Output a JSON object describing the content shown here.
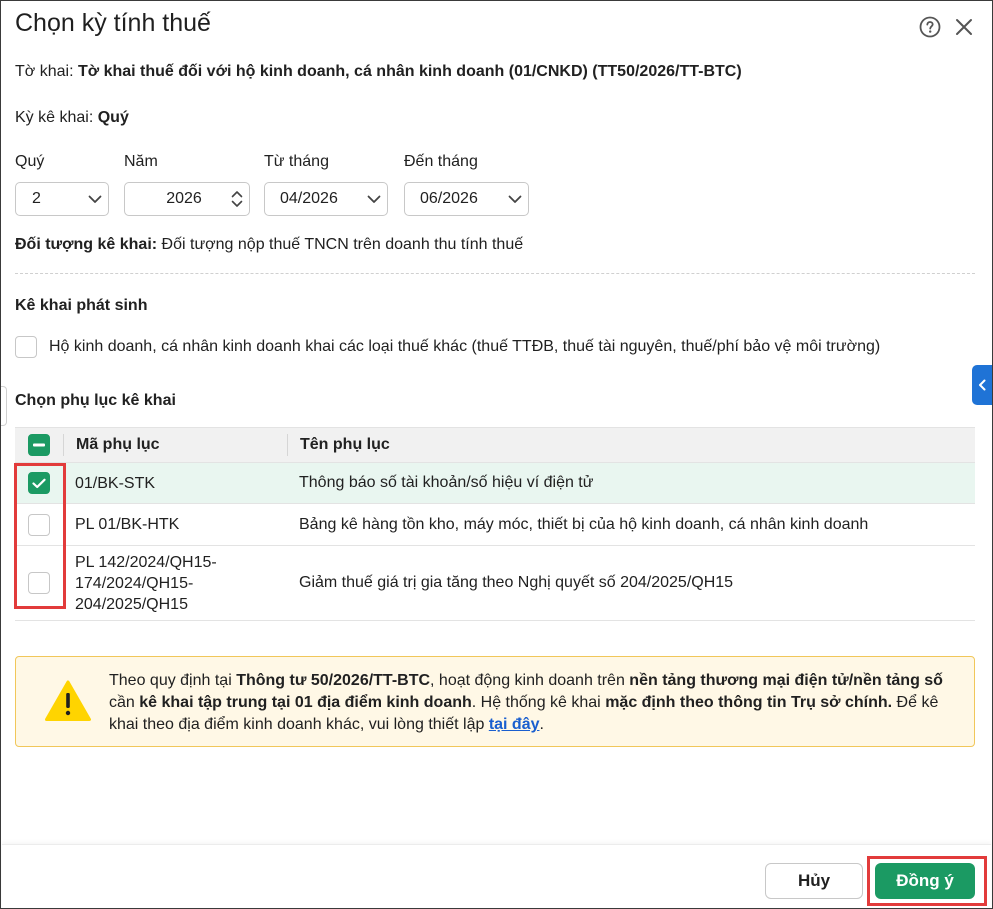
{
  "dialog": {
    "title": "Chọn kỳ tính thuế"
  },
  "form_info": {
    "to_khai_label": "Tờ khai:",
    "to_khai_value": "Tờ khai thuế đối với hộ kinh doanh, cá nhân kinh doanh (01/CNKD) (TT50/2026/TT-BTC)",
    "ky_ke_khai_label": "Kỳ kê khai:",
    "ky_ke_khai_value": "Quý"
  },
  "fields": {
    "quy_label": "Quý",
    "quy_value": "2",
    "nam_label": "Năm",
    "nam_value": "2026",
    "tu_thang_label": "Từ tháng",
    "tu_thang_value": "04/2026",
    "den_thang_label": "Đến tháng",
    "den_thang_value": "06/2026"
  },
  "doi_tuong": {
    "label": "Đối tượng kê khai:",
    "value": "Đối tượng nộp thuế TNCN trên doanh thu tính thuế"
  },
  "phat_sinh": {
    "title": "Kê khai phát sinh",
    "option_label": "Hộ kinh doanh, cá nhân kinh doanh khai các loại thuế khác (thuế TTĐB, thuế tài nguyên, thuế/phí bảo vệ môi trường)",
    "option_checked": false
  },
  "phu_luc": {
    "title": "Chọn phụ lục kê khai",
    "col_ma": "Mã phụ lục",
    "col_ten": "Tên phụ lục",
    "rows": [
      {
        "ma": "01/BK-STK",
        "ten": "Thông báo số tài khoản/số hiệu ví điện tử",
        "checked": true
      },
      {
        "ma": "PL 01/BK-HTK",
        "ten": "Bảng kê hàng tồn kho, máy móc, thiết bị của hộ kinh doanh, cá nhân kinh doanh",
        "checked": false
      },
      {
        "ma_lines": [
          "PL 142/2024/QH15-",
          "174/2024/QH15-",
          "204/2025/QH15"
        ],
        "ten": "Giảm thuế giá trị gia tăng theo Nghị quyết số 204/2025/QH15",
        "checked": false
      }
    ]
  },
  "warning": {
    "t1": "Theo quy định tại ",
    "b1": "Thông tư 50/2026/TT-BTC",
    "t2": ", hoạt động kinh doanh trên ",
    "b2": "nền tảng thương mại điện tử/nền tảng số",
    "t3": " cần ",
    "b3": "kê khai tập trung tại 01 địa điểm kinh doanh",
    "t4": ". Hệ thống kê khai ",
    "b4": "mặc định theo thông tin Trụ sở chính.",
    "t5": " Để kê khai theo địa điểm kinh doanh khác, vui lòng thiết lập ",
    "link": "tại đây",
    "t6": "."
  },
  "footer": {
    "cancel_label": "Hủy",
    "ok_label": "Đồng ý"
  },
  "colors": {
    "primary_green": "#1b9a63",
    "highlight_red": "#e23b3b",
    "warning_bg": "#fff8e6",
    "side_tab_blue": "#1f73d6"
  }
}
